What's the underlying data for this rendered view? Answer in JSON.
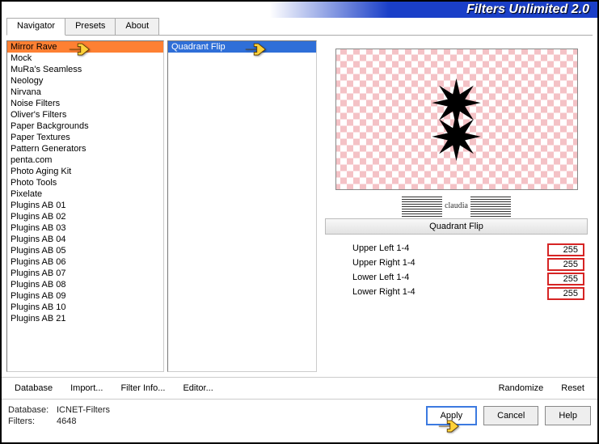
{
  "app_title": "Filters Unlimited 2.0",
  "tabs": [
    "Navigator",
    "Presets",
    "About"
  ],
  "active_tab": 0,
  "left_list": [
    "Mirror Rave",
    "Mock",
    "MuRa's Seamless",
    "Neology",
    "Nirvana",
    "Noise Filters",
    "Oliver's Filters",
    "Paper Backgrounds",
    "Paper Textures",
    "Pattern Generators",
    "penta.com",
    "Photo Aging Kit",
    "Photo Tools",
    "Pixelate",
    "Plugins AB 01",
    "Plugins AB 02",
    "Plugins AB 03",
    "Plugins AB 04",
    "Plugins AB 05",
    "Plugins AB 06",
    "Plugins AB 07",
    "Plugins AB 08",
    "Plugins AB 09",
    "Plugins AB 10",
    "Plugins AB 21"
  ],
  "left_selected": 0,
  "mid_list": [
    "Quadrant Flip"
  ],
  "mid_selected": 0,
  "filter_name": "Quadrant Flip",
  "claudia": "claudia",
  "params": [
    {
      "label": "Upper Left 1-4",
      "value": "255"
    },
    {
      "label": "Upper Right 1-4",
      "value": "255"
    },
    {
      "label": "Lower Left 1-4",
      "value": "255"
    },
    {
      "label": "Lower Right 1-4",
      "value": "255"
    }
  ],
  "midbar": {
    "database": "Database",
    "import": "Import...",
    "filter_info": "Filter Info...",
    "editor": "Editor...",
    "randomize": "Randomize",
    "reset": "Reset"
  },
  "footer": {
    "db_label": "Database:",
    "db_value": "ICNET-Filters",
    "filters_label": "Filters:",
    "filters_value": "4648",
    "apply": "Apply",
    "cancel": "Cancel",
    "help": "Help"
  }
}
